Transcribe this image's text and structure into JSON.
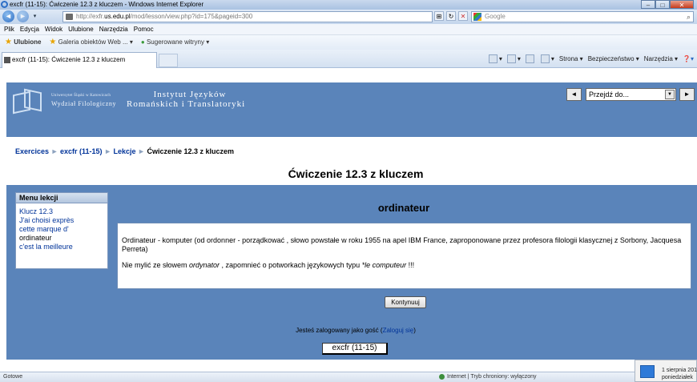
{
  "browser": {
    "window_title": "excfr (11-15): Ćwiczenie 12.3 z kluczem - Windows Internet Explorer",
    "url_prefix": "http://exfr.",
    "url_domain": "us.edu.pl",
    "url_path": "/mod/lesson/view.php?id=175&pageid=300",
    "search_placeholder": "Google",
    "menu": [
      "Plik",
      "Edycja",
      "Widok",
      "Ulubione",
      "Narzędzia",
      "Pomoc"
    ],
    "favorites": {
      "label": "Ulubione",
      "gallery": "Galeria obiektów Web ... ▾",
      "suggested": "Sugerowane witryny ▾"
    },
    "tab_title": "excfr (11-15): Ćwiczenie 12.3 z kluczem",
    "commands": {
      "page": "Strona ▾",
      "safety": "Bezpieczeństwo ▾",
      "tools": "Narzędzia ▾"
    },
    "status": {
      "left": "Gotowe",
      "zone": "Internet | Tryb chroniony: wyłączony"
    },
    "clock": {
      "date": "1 sierpnia 201",
      "day": "poniedziałek"
    }
  },
  "site": {
    "uni_line1": "Uniwersytet Śląski w Katowicach",
    "uni_line2": "Wydział Filologiczny",
    "inst_line1": "Instytut Języków",
    "inst_line2": "Romańskich i Translatoryki",
    "jump_placeholder": "Przejdź do...",
    "prev_label": "◄",
    "next_label": "►"
  },
  "breadcrumb": {
    "items": [
      "Exercices",
      "excfr (11-15)",
      "Lekcje",
      "Ćwiczenie 12.3 z kluczem"
    ],
    "sep": "►"
  },
  "lesson": {
    "title": "Ćwiczenie 12.3 z kluczem",
    "menu_title": "Menu lekcji",
    "menu_items": [
      "Klucz 12.3",
      "J'ai choisi exprès",
      "cette marque d'",
      "ordinateur",
      "c'est la meilleure"
    ],
    "page_heading": "ordinateur",
    "para1": "Ordinateur - komputer (od ordonner - porządkować , słowo powstałe w roku 1955 na apel IBM France, zaproponowane przez profesora filologii klasycznej z Sorbony, Jacquesa Perreta)",
    "para2_a": "Nie mylić ze słowem ",
    "para2_b": "ordynator",
    "para2_c": " , zapomnieć o potworkach językowych typu ",
    "para2_d": "*le computeur",
    "para2_e": " !!!",
    "continue_label": "Kontynuuj"
  },
  "footer": {
    "login_text": "Jesteś zalogowany jako gość (",
    "login_link": "Zaloguj się",
    "login_end": ")",
    "course_button": "excfr (11-15)"
  }
}
